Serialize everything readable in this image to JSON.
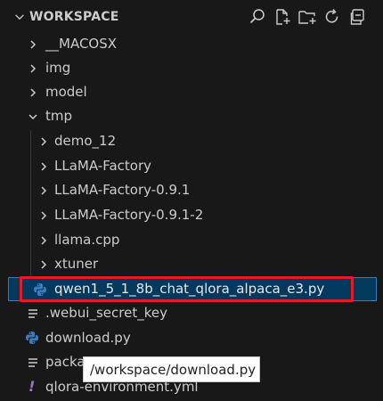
{
  "explorer": {
    "title": "WORKSPACE",
    "toolbar": [
      {
        "name": "search-icon",
        "label": "Search"
      },
      {
        "name": "new-file-icon",
        "label": "New File"
      },
      {
        "name": "new-folder-icon",
        "label": "New Folder"
      },
      {
        "name": "refresh-icon",
        "label": "Refresh Explorer"
      },
      {
        "name": "collapse-all-icon",
        "label": "Collapse Folders"
      }
    ],
    "tree": {
      "macosx": "__MACOSX",
      "img": "img",
      "model": "model",
      "tmp": "tmp",
      "demo_12": "demo_12",
      "llama_factory": "LLaMA-Factory",
      "llama_factory_091": "LLaMA-Factory-0.9.1",
      "llama_factory_091_2": "LLaMA-Factory-0.9.1-2",
      "llama_cpp": "llama.cpp",
      "xtuner": "xtuner",
      "qwen_file": "qwen1_5_1_8b_chat_qlora_alpaca_e3.py",
      "webui_secret_key": ".webui_secret_key",
      "download_py": "download.py",
      "packa_partial": "packa",
      "qlora_env": "qlora-environment.yml"
    },
    "tooltip": "/workspace/download.py",
    "colors": {
      "background": "#181818",
      "selected_bg": "#04395e",
      "highlight_border": "#e41b23",
      "python_icon": "#3b7bbf",
      "yaml_icon": "#a074c4"
    }
  }
}
